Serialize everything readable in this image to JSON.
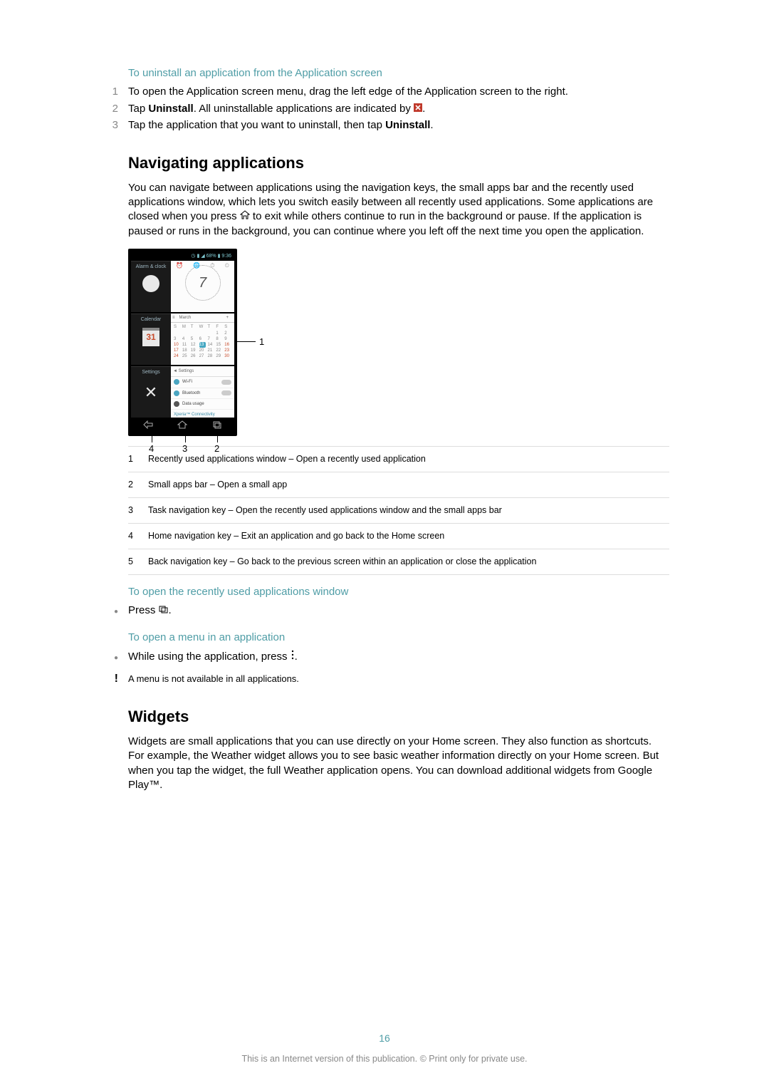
{
  "uninstall": {
    "heading": "To uninstall an application from the Application screen",
    "s1_num": "1",
    "s1": "To open the Application screen menu, drag the left edge of the Application screen to the right.",
    "s2_num": "2",
    "s2a": "Tap ",
    "s2b": "Uninstall",
    "s2c": ". All uninstallable applications are indicated by ",
    "s2d": ".",
    "s3_num": "3",
    "s3a": "Tap the application that you want to uninstall, then tap ",
    "s3b": "Uninstall",
    "s3c": "."
  },
  "nav": {
    "heading": "Navigating applications",
    "para_a": "You can navigate between applications using the navigation keys, the small apps bar and the recently used applications window, which lets you switch easily between all recently used applications. Some applications are closed when you press ",
    "para_b": " to exit while others continue to run in the background or pause. If the application is paused or runs in the background, you can continue where you left off the next time you open the application."
  },
  "device": {
    "status": "9:36",
    "status_pct": "68%",
    "t1_label": "Alarm & clock",
    "t1_face": "7",
    "t2_label": "Calendar",
    "t2_icon": "31",
    "t2_month": "March",
    "t3_label": "Settings",
    "t3_wifi": "Wi-Fi",
    "t3_bt": "Bluetooth",
    "t3_data": "Data usage",
    "t3_xp": "Xperia™ Connectivity",
    "t3_header": "Settings"
  },
  "annot": {
    "a1": "1",
    "a2": "2",
    "a3": "3",
    "a4": "4"
  },
  "legend": {
    "n1": "1",
    "l1": "Recently used applications window – Open a recently used application",
    "n2": "2",
    "l2": "Small apps bar – Open a small app",
    "n3": "3",
    "l3": "Task navigation key – Open the recently used applications window and the small apps bar",
    "n4": "4",
    "l4": "Home navigation key – Exit an application and go back to the Home screen",
    "n5": "5",
    "l5": "Back navigation key – Go back to the previous screen within an application or close the application"
  },
  "recent": {
    "heading": "To open the recently used applications window",
    "b1a": "Press ",
    "b1b": "."
  },
  "menu": {
    "heading": "To open a menu in an application",
    "b1a": "While using the application, press ",
    "b1b": ".",
    "note": "A menu is not available in all applications."
  },
  "widgets": {
    "heading": "Widgets",
    "para": "Widgets are small applications that you can use directly on your Home screen. They also function as shortcuts. For example, the Weather widget allows you to see basic weather information directly on your Home screen. But when you tap the widget, the full Weather application opens. You can download additional widgets from Google Play™."
  },
  "page": {
    "num": "16",
    "footer": "This is an Internet version of this publication. © Print only for private use."
  }
}
